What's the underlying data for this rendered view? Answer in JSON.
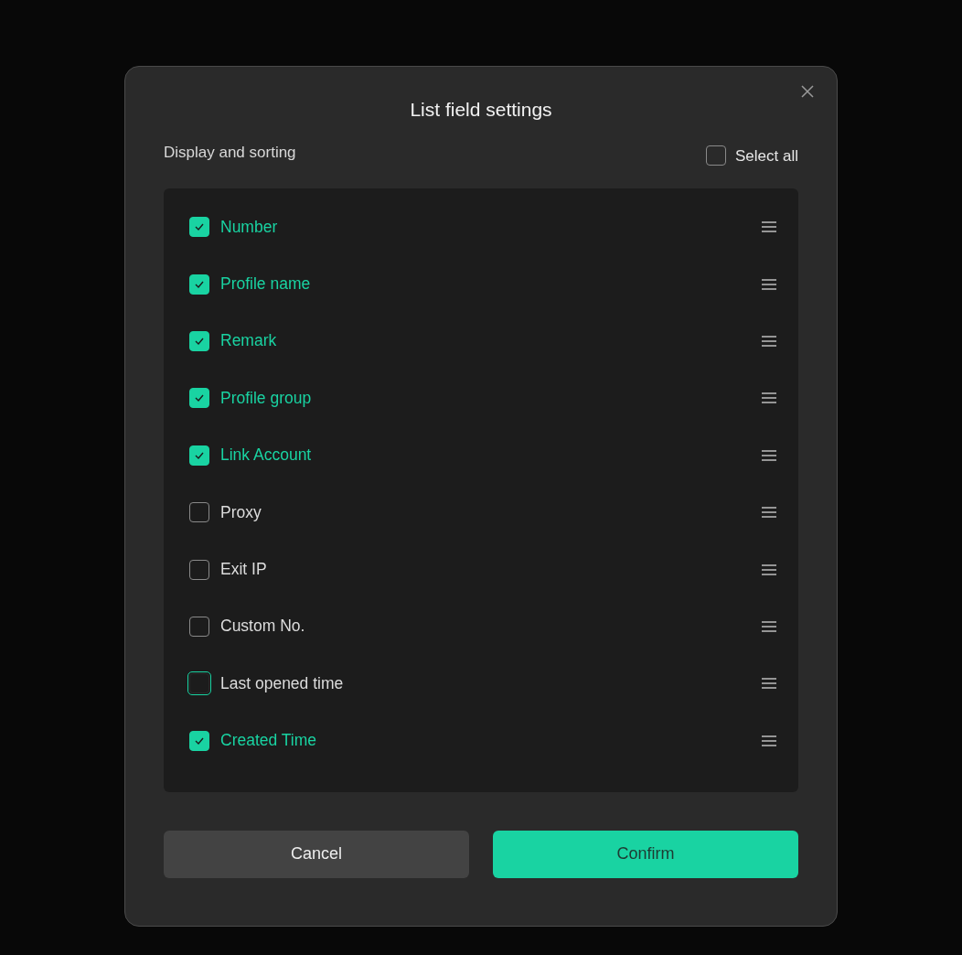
{
  "dialog": {
    "title": "List field settings",
    "section_label": "Display and sorting",
    "select_all": {
      "label": "Select all",
      "checked": false
    },
    "fields": [
      {
        "label": "Number",
        "checked": true,
        "focused": false
      },
      {
        "label": "Profile name",
        "checked": true,
        "focused": false
      },
      {
        "label": "Remark",
        "checked": true,
        "focused": false
      },
      {
        "label": "Profile group",
        "checked": true,
        "focused": false
      },
      {
        "label": "Link Account",
        "checked": true,
        "focused": false
      },
      {
        "label": "Proxy",
        "checked": false,
        "focused": false
      },
      {
        "label": "Exit IP",
        "checked": false,
        "focused": false
      },
      {
        "label": "Custom No.",
        "checked": false,
        "focused": false
      },
      {
        "label": "Last opened time",
        "checked": false,
        "focused": true
      },
      {
        "label": "Created Time",
        "checked": true,
        "focused": false
      }
    ],
    "buttons": [
      {
        "label": "Cancel",
        "kind": "secondary"
      },
      {
        "label": "Confirm",
        "kind": "primary"
      }
    ]
  }
}
